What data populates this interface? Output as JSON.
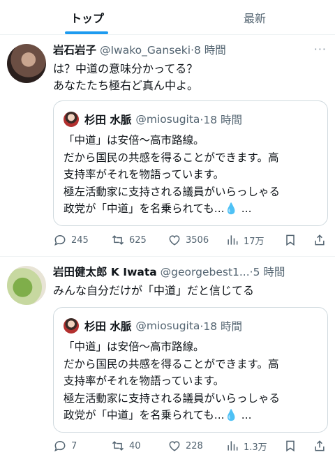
{
  "tabs": {
    "top": "トップ",
    "latest": "最新"
  },
  "tweets": [
    {
      "name": "岩石岩子",
      "handle": "@Iwako_Ganseki",
      "time": "·8 時間",
      "more": "···",
      "text_lines": [
        "は？中道の意味分かってる？",
        "あなたたち極右ど真ん中よ。"
      ],
      "quote": {
        "name": "杉田 水脈",
        "handle": "@miosugita",
        "time": "·18 時間",
        "lines": [
          "「中道」は安倍〜高市路線。",
          "だから国民の共感を得ることができます。高",
          "支持率がそれを物語っています。",
          "極左活動家に支持される議員がいらっしゃる",
          "政党が「中道」を名乗られても..."
        ],
        "drop": "💧",
        "ellipsis": " ..."
      },
      "counts": {
        "reply": "245",
        "retweet": "625",
        "like": "3506",
        "views": "17万"
      }
    },
    {
      "name": "岩田健太郎 K Iwata",
      "handle": "@georgebest1...",
      "time": "·5 時間",
      "more": "···",
      "text_lines": [
        "みんな自分だけが「中道」だと信じてる"
      ],
      "quote": {
        "name": "杉田 水脈",
        "handle": "@miosugita",
        "time": "·18 時間",
        "lines": [
          "「中道」は安倍〜高市路線。",
          "だから国民の共感を得ることができます。高",
          "支持率がそれを物語っています。",
          "極左活動家に支持される議員がいらっしゃる",
          "政党が「中道」を名乗られても..."
        ],
        "drop": "💧",
        "ellipsis": " ..."
      },
      "counts": {
        "reply": "7",
        "retweet": "40",
        "like": "228",
        "views": "1.3万"
      }
    }
  ],
  "icons": [
    "reply-icon",
    "retweet-icon",
    "like-icon",
    "views-icon",
    "bookmark-icon",
    "share-icon",
    "more-icon"
  ],
  "colors": {
    "accent": "#1d9bf0",
    "muted": "#536471",
    "border": "#cfd9de"
  }
}
